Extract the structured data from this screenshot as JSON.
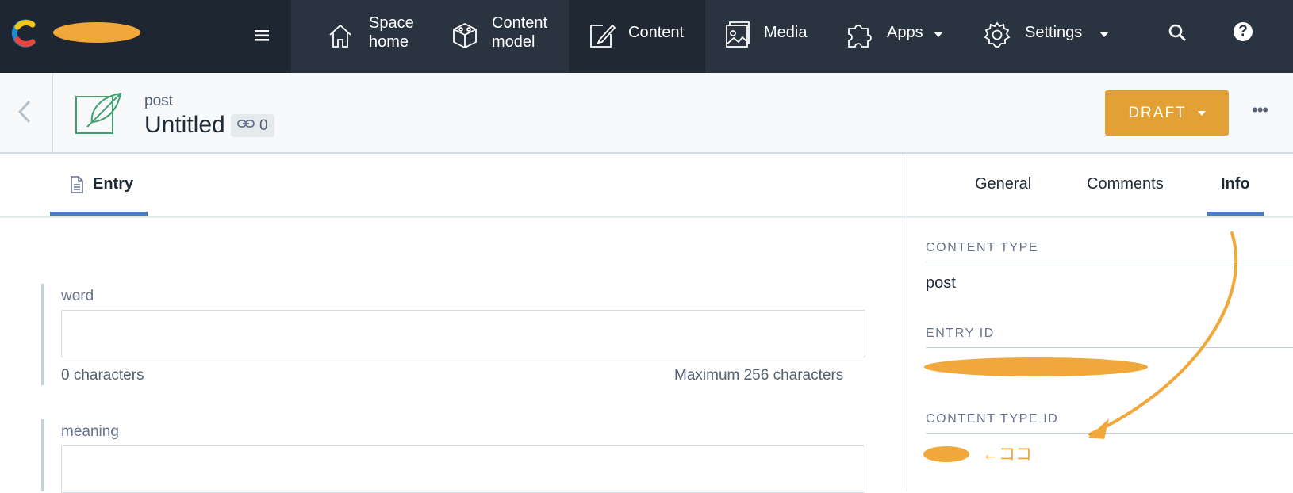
{
  "nav": {
    "items": [
      {
        "id": "space-home",
        "label_line1": "Space",
        "label_line2": "home"
      },
      {
        "id": "content-model",
        "label_line1": "Content",
        "label_line2": "model"
      },
      {
        "id": "content",
        "label": "Content"
      },
      {
        "id": "media",
        "label": "Media"
      },
      {
        "id": "apps",
        "label": "Apps"
      },
      {
        "id": "settings",
        "label": "Settings"
      }
    ],
    "help_glyph": "?"
  },
  "entry": {
    "content_type": "post",
    "title": "Untitled",
    "reference_count": "0",
    "status_label": "DRAFT",
    "more_glyph": "•••"
  },
  "tabs": {
    "entry": "Entry",
    "general": "General",
    "comments": "Comments",
    "info": "Info",
    "active_right": "info"
  },
  "fields": [
    {
      "label": "word",
      "value": "",
      "count": "0 characters",
      "max": "Maximum 256 characters"
    },
    {
      "label": "meaning",
      "value": ""
    }
  ],
  "info": {
    "content_type_label": "CONTENT TYPE",
    "content_type_value": "post",
    "entry_id_label": "ENTRY ID",
    "content_type_id_label": "CONTENT TYPE ID",
    "annotation": "←ココ"
  },
  "colors": {
    "nav_bg": "#2a3441",
    "accent_blue": "#4a7cc7",
    "draft_orange": "#e3a035",
    "annotation_orange": "#f0a83a"
  }
}
